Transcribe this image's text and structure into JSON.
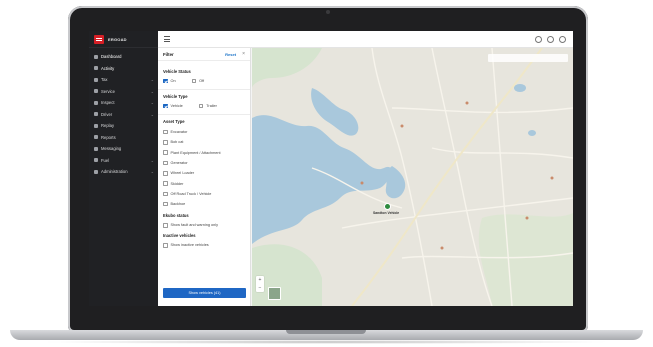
{
  "brand": {
    "name": "ERGOAD"
  },
  "sidebar": {
    "items": [
      {
        "label": "Dashboard",
        "has_chevron": false
      },
      {
        "label": "Activity",
        "has_chevron": false
      },
      {
        "label": "Tax",
        "has_chevron": true
      },
      {
        "label": "Service",
        "has_chevron": true
      },
      {
        "label": "Inspect",
        "has_chevron": true
      },
      {
        "label": "Driver",
        "has_chevron": true
      },
      {
        "label": "Replay",
        "has_chevron": false
      },
      {
        "label": "Reports",
        "has_chevron": false
      },
      {
        "label": "Messaging",
        "has_chevron": false
      },
      {
        "label": "Fuel",
        "has_chevron": true
      },
      {
        "label": "Administration",
        "has_chevron": true
      }
    ],
    "chevron_glyph": "⌄"
  },
  "filter": {
    "title": "Filter",
    "reset_label": "Reset",
    "close_glyph": "×",
    "vehicle_status": {
      "heading": "Vehicle Status",
      "options": [
        {
          "label": "On",
          "checked": true
        },
        {
          "label": "Off",
          "checked": false
        }
      ]
    },
    "vehicle_type": {
      "heading": "Vehicle Type",
      "options": [
        {
          "label": "Vehicle",
          "checked": true
        },
        {
          "label": "Trailer",
          "checked": false
        }
      ]
    },
    "asset_type": {
      "heading": "Asset Type",
      "options": [
        {
          "label": "Excavator",
          "checked": false
        },
        {
          "label": "Bob cat",
          "checked": false
        },
        {
          "label": "Plant Equipment / Attachment",
          "checked": false
        },
        {
          "label": "Generator",
          "checked": false
        },
        {
          "label": "Wheel Loader",
          "checked": false
        },
        {
          "label": "Skidder",
          "checked": false
        },
        {
          "label": "Off Road Truck / Vehicle",
          "checked": false
        },
        {
          "label": "Backhoe",
          "checked": false
        }
      ]
    },
    "ekubo_status": {
      "heading": "Ekubo status",
      "options": [
        {
          "label": "Show fault and warning only",
          "checked": false
        }
      ]
    },
    "inactive": {
      "heading": "Inactive vehicles",
      "options": [
        {
          "label": "Show inactive vehicles",
          "checked": false
        }
      ]
    },
    "show_button": "Show vehicles (41)"
  },
  "map": {
    "vehicle_label": "Sandton Vehicle",
    "zoom_in": "+",
    "zoom_out": "−",
    "colors": {
      "water": "#a9c8dc",
      "land": "#e8e6df",
      "road": "#f6f3ea",
      "vehicle": "#2e8b3f"
    }
  }
}
